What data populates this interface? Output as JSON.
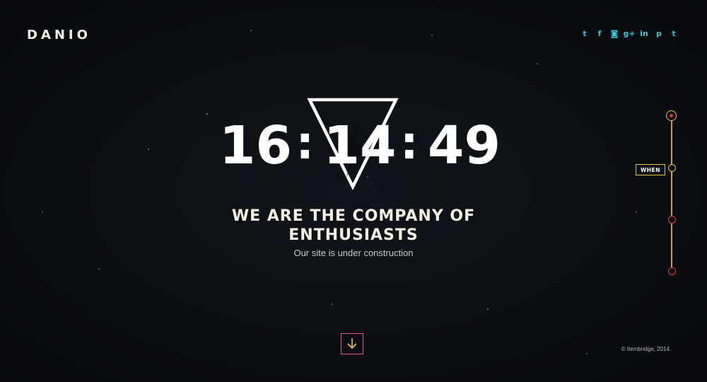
{
  "brand": {
    "logo": "DANIO"
  },
  "social": [
    {
      "name": "twitter-icon",
      "glyph": "t"
    },
    {
      "name": "facebook-icon",
      "glyph": "f"
    },
    {
      "name": "instagram-icon",
      "glyph": "◙"
    },
    {
      "name": "google-plus-icon",
      "glyph": "g+"
    },
    {
      "name": "linkedin-icon",
      "glyph": "in"
    },
    {
      "name": "pinterest-icon",
      "glyph": "p"
    },
    {
      "name": "tumblr-icon",
      "glyph": "t"
    }
  ],
  "countdown": {
    "hours": "16",
    "minutes": "14",
    "seconds": "49",
    "separator": ":"
  },
  "hero": {
    "headline_line1": "WE ARE THE COMPANY OF",
    "headline_line2": "ENTHUSIASTS",
    "subtitle": "Our site is under construction"
  },
  "timeline": {
    "active_label": "WHEN"
  },
  "footer": {
    "copyright": "© Itembridge, 2014."
  },
  "colors": {
    "accent": "#e8c442",
    "social": "#2fc8d6",
    "timeline_dot": "#e03c3c",
    "button_border": "#e85a78"
  }
}
